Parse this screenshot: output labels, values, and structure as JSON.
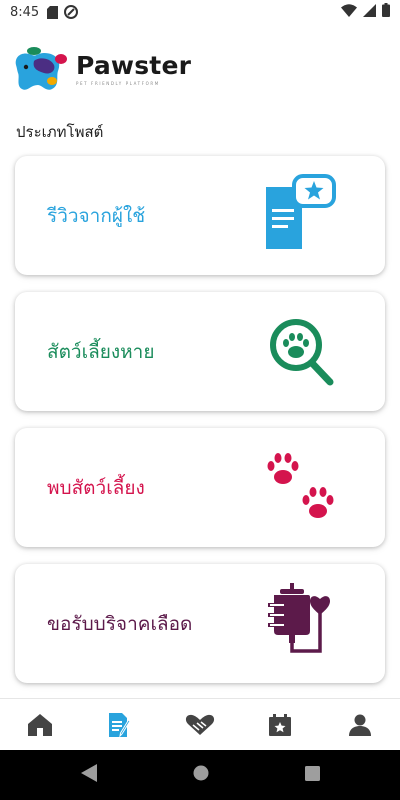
{
  "status_bar": {
    "time": "8:45",
    "icons": [
      "sd-card-icon",
      "do-not-disturb-icon",
      "wifi-icon",
      "signal-icon",
      "battery-icon"
    ]
  },
  "brand": {
    "name": "Pawster",
    "tagline": "PET FRIENDLY PLATFORM"
  },
  "section_title": "ประเภทโพสต์",
  "post_types": [
    {
      "label": "รีวิวจากผู้ใช้",
      "icon": "review-document-star-icon",
      "color": "#29a3dd"
    },
    {
      "label": "สัตว์เลี้ยงหาย",
      "icon": "search-paw-icon",
      "color": "#1a8c5b"
    },
    {
      "label": "พบสัตว์เลี้ยง",
      "icon": "paw-prints-icon",
      "color": "#d4144d"
    },
    {
      "label": "ขอรับบริจาคเลือด",
      "icon": "blood-bag-heart-icon",
      "color": "#5c1a4a"
    }
  ],
  "bottom_nav": {
    "items": [
      "home-icon",
      "posts-icon",
      "adoption-handshake-icon",
      "events-calendar-icon",
      "profile-icon"
    ],
    "active": "posts-icon",
    "active_color": "#29a3dd",
    "inactive_color": "#444444"
  }
}
